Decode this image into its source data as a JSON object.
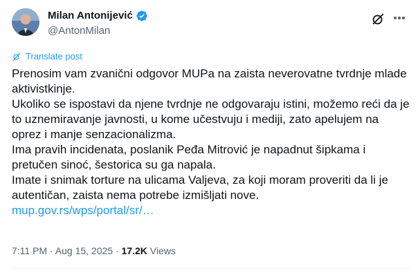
{
  "author": {
    "name": "Milan Antonijević",
    "handle": "@AntonMilan",
    "verified": true
  },
  "translate_label": "Translate post",
  "post": {
    "lines": [
      "Prenosim vam zvanični odgovor MUPa na zaista neverovatne tvrdnje mlade aktivistkinje.",
      "Ukoliko se ispostavi da njene tvrdnje ne odgovaraju istini, možemo reći da je to uznemiravanje javnosti, u kome učestvuju i mediji, zato apelujem na oprez i manje senzacionalizma.",
      "Ima pravih incidenata, poslanik Peđa Mitrović je napadnut šipkama i pretučen sinoć, šestorica su ga napala.",
      "Imate i snimak torture na ulicama Valjeva, za koji moram proveriti da li je autentičan, zaista nema potrebe izmišljati nove."
    ],
    "link": "mup.gov.rs/wps/portal/sr/…"
  },
  "meta": {
    "time": "7:11 PM",
    "separator1": " · ",
    "date": "Aug 15, 2025",
    "separator2": " · ",
    "views_count": "17.2K",
    "views_label": " Views"
  },
  "colors": {
    "accent": "#1d9bf0",
    "text": "#0f1419",
    "secondary": "#536471"
  },
  "icons": [
    "verified-badge-icon",
    "grok-icon",
    "more-icon",
    "translate-icon"
  ]
}
